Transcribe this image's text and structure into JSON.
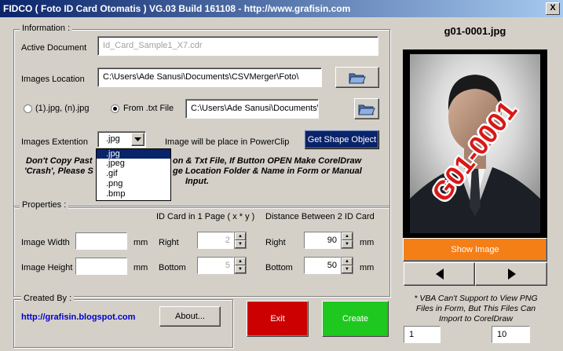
{
  "window": {
    "title": "FIDCO ( Foto ID Card Otomatis ) VG.03 Build 161108 - http://www.grafisin.com",
    "close_label": "X"
  },
  "information": {
    "legend": "Information :",
    "active_document_label": "Active Document",
    "active_document_value": "Id_Card_Sample1_X7.cdr",
    "images_location_label": "Images Location",
    "images_location_value": "C:\\Users\\Ade Sanusi\\Documents\\CSVMerger\\Foto\\",
    "radio_jpg_label": "(1).jpg, (n).jpg",
    "radio_txt_label": "From .txt File",
    "txt_path_value": "C:\\Users\\Ade Sanusi\\Documents\\CSVM",
    "images_extension_label": "Images Extention",
    "extension_selected": ".jpg",
    "extension_options": [
      ".jpg",
      ".jpeg",
      ".gif",
      ".png",
      ".bmp"
    ],
    "powerclip_text": "Image will be place in PowerClip",
    "get_shape_button": "Get Shape Object",
    "warning_line1_a": "Don't Copy Past",
    "warning_line1_b": "on & Txt File, If Button OPEN Make CorelDraw",
    "warning_line2_a": "'Crash', Please S",
    "warning_line2_b": "ge Location Folder & Name in Form or Manual",
    "warning_line3": "Input."
  },
  "properties": {
    "legend": "Properties :",
    "id_card_header": "ID Card in 1 Page ( x * y )",
    "distance_header": "Distance Between 2 ID Card",
    "image_width_label": "Image Width",
    "image_height_label": "Image Height",
    "image_width_value": "",
    "image_height_value": "",
    "mm": "mm",
    "right_label": "Right",
    "bottom_label": "Bottom",
    "cards_right": "2",
    "cards_bottom": "5",
    "distance_right": "90",
    "distance_bottom": "50"
  },
  "created_by": {
    "legend": "Created By :",
    "link": "http://grafisin.blogspot.com",
    "about_button": "About..."
  },
  "actions": {
    "exit_button": "Exit",
    "create_button": "Create"
  },
  "preview": {
    "filename": "g01-0001.jpg",
    "overlay_text": "G01-0001",
    "show_image_button": "Show Image",
    "note": "* VBA Can't Support to View PNG Files in Form, But This Files Can Import to CorelDraw",
    "page_current": "1",
    "page_total": "10"
  },
  "colors": {
    "exit": "#cc0000",
    "create": "#1fc81f",
    "show_image": "#f57f17",
    "get_shape": "#0a246a",
    "link": "#0000cc",
    "overlay": "#d81818"
  }
}
